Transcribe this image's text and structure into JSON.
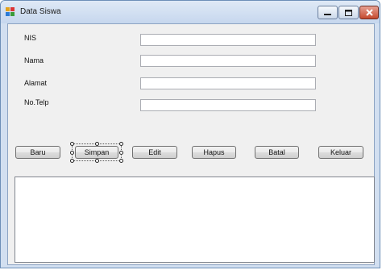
{
  "window": {
    "title": "Data Siswa",
    "controls": [
      "minimize-icon",
      "maximize-icon",
      "close-icon"
    ]
  },
  "form": {
    "fields": [
      {
        "label": "NIS",
        "value": ""
      },
      {
        "label": "Nama",
        "value": ""
      },
      {
        "label": "Alamat",
        "value": ""
      },
      {
        "label": "No.Telp",
        "value": ""
      }
    ],
    "buttons": [
      "Baru",
      "Simpan",
      "Edit",
      "Hapus",
      "Batal",
      "Keluar"
    ],
    "selected_button": "Simpan"
  },
  "colors": {
    "window_frame": "#c6d7ee",
    "client_background": "#f0f0f0",
    "close_button": "#c5492e"
  }
}
